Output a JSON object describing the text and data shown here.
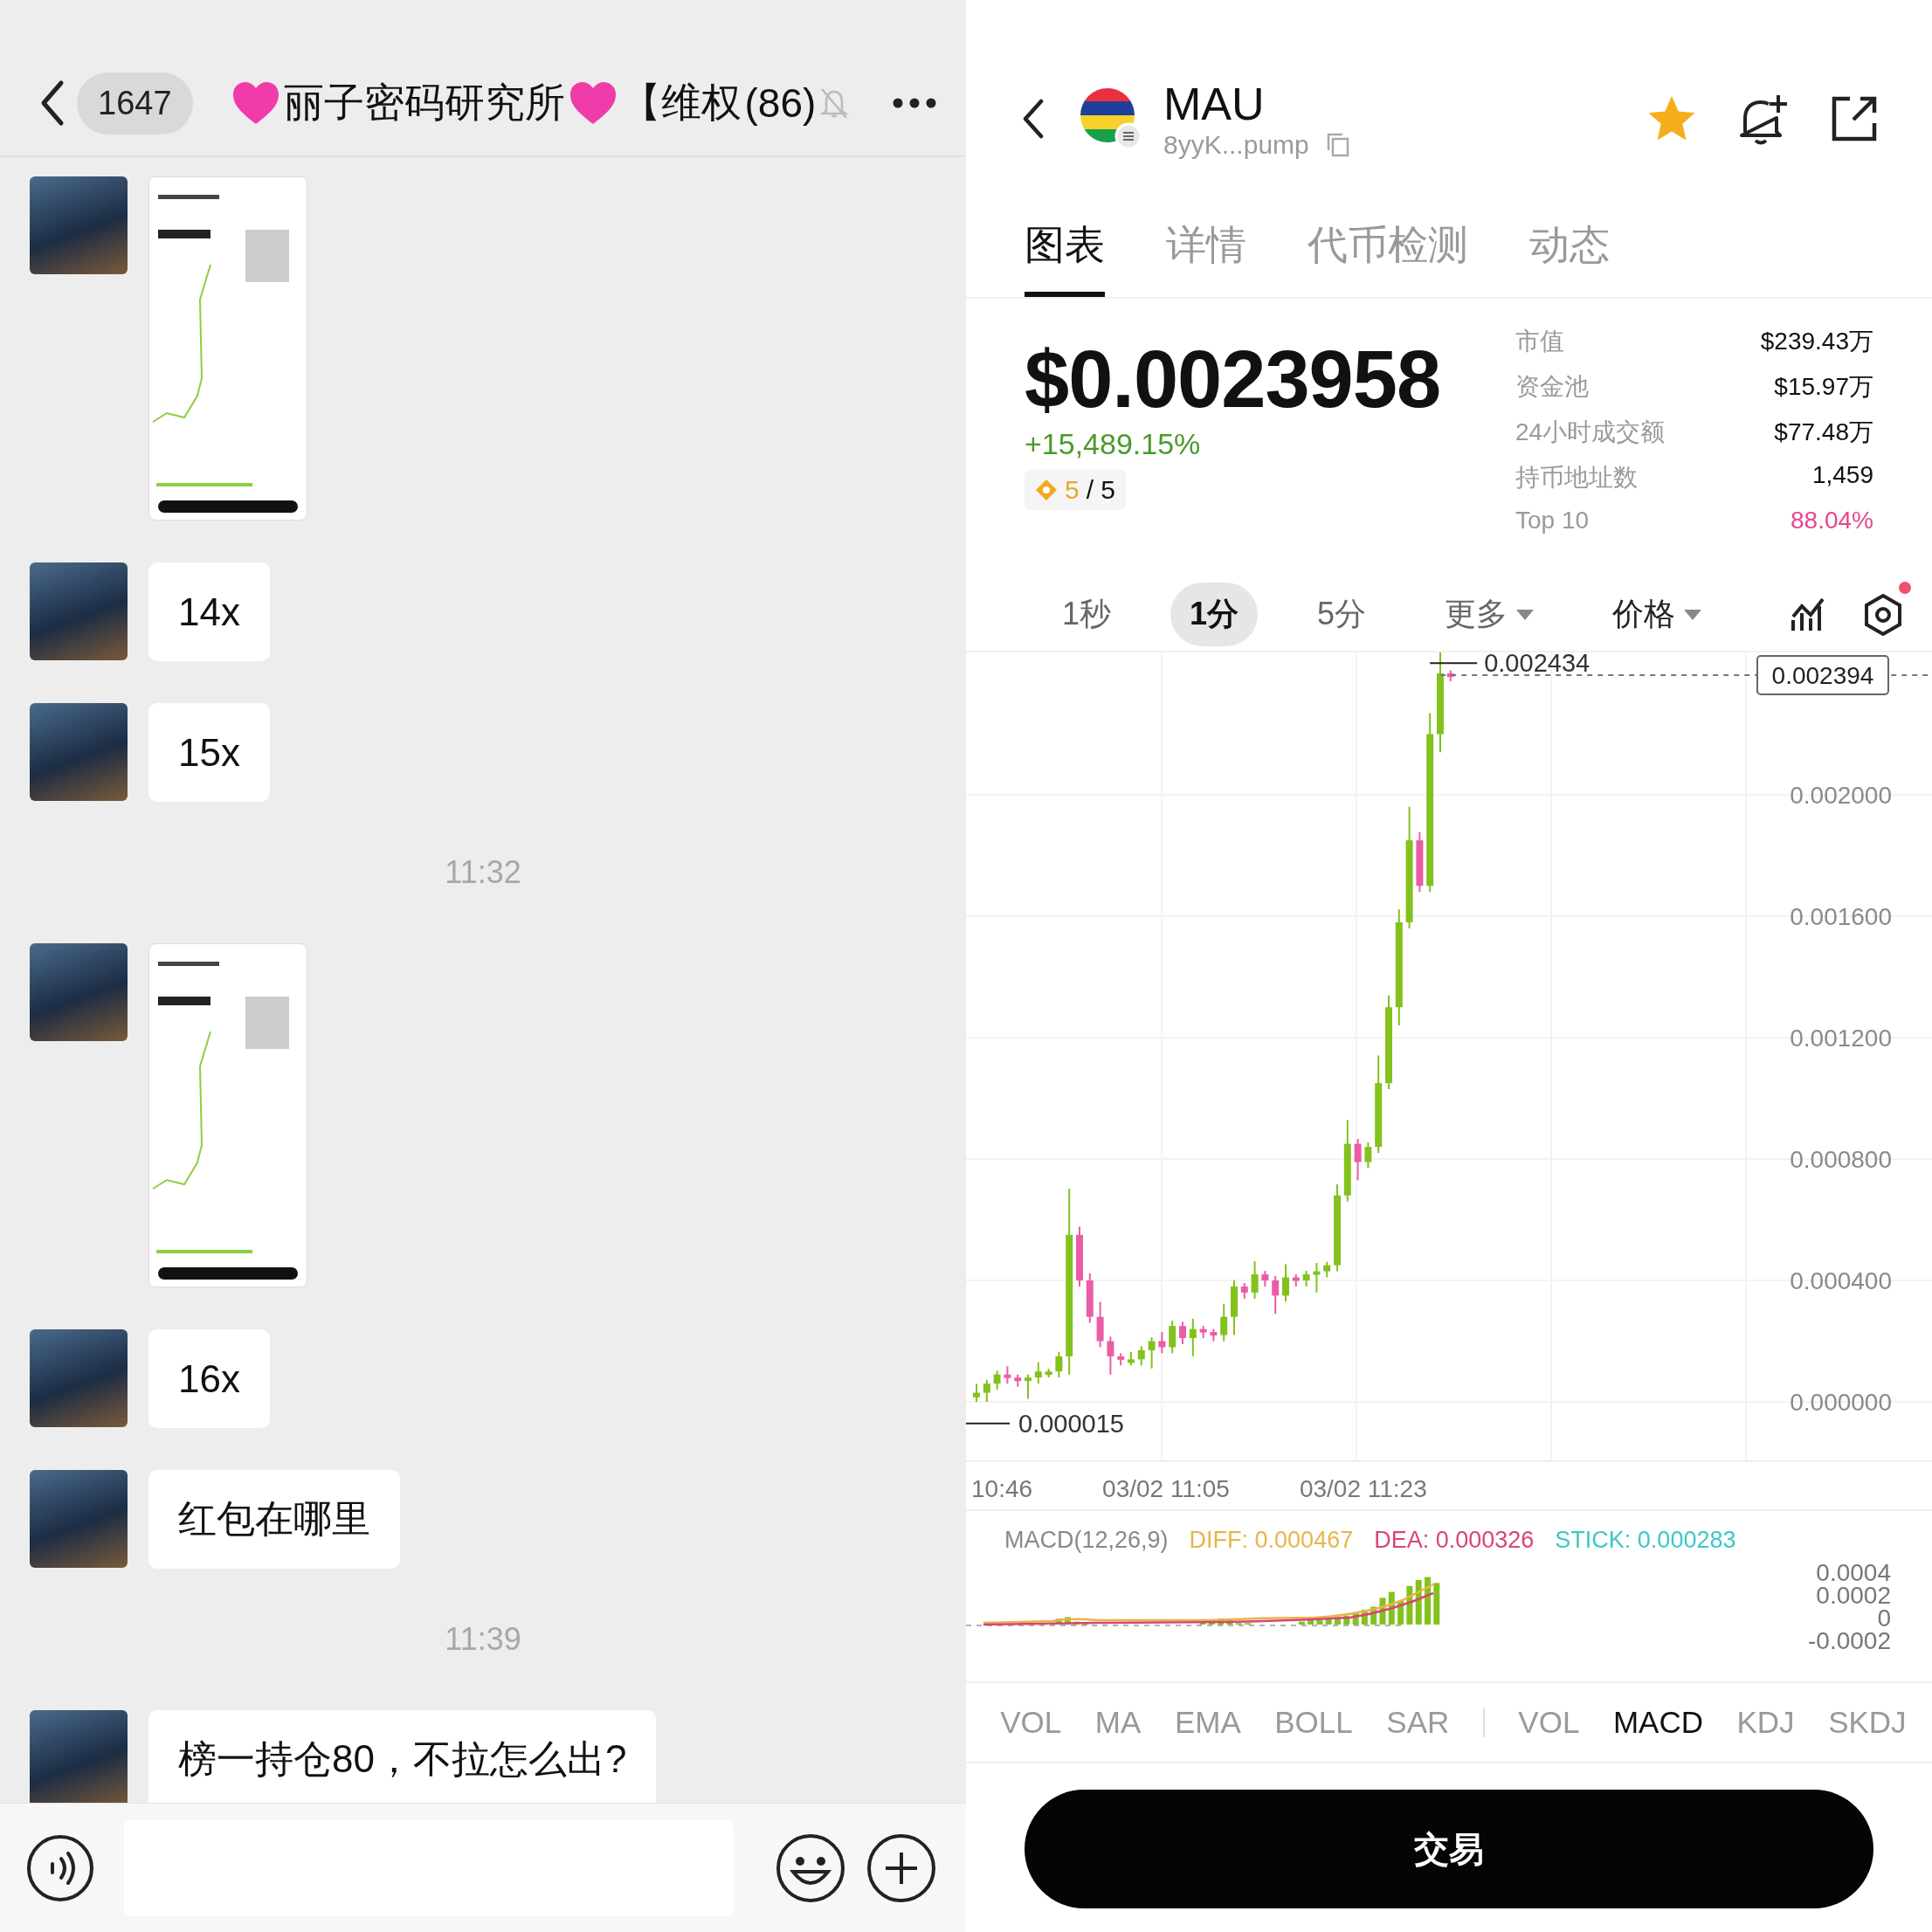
{
  "chat": {
    "back_count": "1647",
    "title": "丽子密码研究所",
    "title_suffix": "【维权",
    "member_count": "(86)",
    "muted": true,
    "messages": [
      {
        "kind": "image"
      },
      {
        "kind": "text",
        "text": "14x"
      },
      {
        "kind": "text",
        "text": "15x"
      },
      {
        "kind": "time",
        "text": "11:32"
      },
      {
        "kind": "image"
      },
      {
        "kind": "text",
        "text": "16x"
      },
      {
        "kind": "text",
        "text": "红包在哪里"
      },
      {
        "kind": "time",
        "text": "11:39"
      },
      {
        "kind": "text",
        "text": "榜一持仓80，不拉怎么出?"
      }
    ]
  },
  "token": {
    "symbol": "MAU",
    "address": "8yyK...pump",
    "favorite": true,
    "tabs": [
      {
        "label": "图表",
        "selected": true
      },
      {
        "label": "详情",
        "selected": false
      },
      {
        "label": "代币检测",
        "selected": false
      },
      {
        "label": "动态",
        "selected": false
      }
    ],
    "price": "$0.0023958",
    "change": "+15,489.15%",
    "score": "5",
    "score_total": "/ 5",
    "stats": [
      {
        "label": "市值",
        "value": "$239.43万",
        "kind": "plain"
      },
      {
        "label": "资金池",
        "value": "$15.97万",
        "kind": "plain"
      },
      {
        "label": "24小时成交额",
        "value": "$77.48万",
        "kind": "plain"
      },
      {
        "label": "持币地址数",
        "value": "1,459",
        "kind": "plain"
      },
      {
        "label": "Top 10",
        "value": "88.04%",
        "kind": "highlight"
      }
    ],
    "intervals": [
      {
        "label": "1秒",
        "selected": false,
        "kind": "plain"
      },
      {
        "label": "1分",
        "selected": true,
        "kind": "plain"
      },
      {
        "label": "5分",
        "selected": false,
        "kind": "plain"
      },
      {
        "label": "更多",
        "selected": false,
        "kind": "dropdown"
      }
    ],
    "price_mode": "价格",
    "settings_alert": true,
    "price_axis": [
      "0.002000",
      "0.001600",
      "0.001200",
      "0.000800",
      "0.000400",
      "0.000000"
    ],
    "high_label": "0.002434",
    "current_price": "0.002394",
    "low_label": "0.000015",
    "time_axis": [
      "10:46",
      "03/02 11:05",
      "03/02 11:23"
    ],
    "macd": {
      "title": "MACD(12,26,9)",
      "diff": "DIFF: 0.000467",
      "dea": "DEA: 0.000326",
      "stick": "STICK: 0.000283",
      "axis": [
        "0.0004",
        "0.0002",
        "0",
        "-0.0002"
      ]
    },
    "main_indicators": [
      {
        "label": "VOL",
        "selected": false
      },
      {
        "label": "MA",
        "selected": false
      },
      {
        "label": "EMA",
        "selected": false
      },
      {
        "label": "BOLL",
        "selected": false
      },
      {
        "label": "SAR",
        "selected": false
      }
    ],
    "sub_indicators": [
      {
        "label": "VOL",
        "selected": false
      },
      {
        "label": "MACD",
        "selected": true
      },
      {
        "label": "KDJ",
        "selected": false
      },
      {
        "label": "SKDJ",
        "selected": false
      }
    ],
    "trade_button": "交易"
  }
}
